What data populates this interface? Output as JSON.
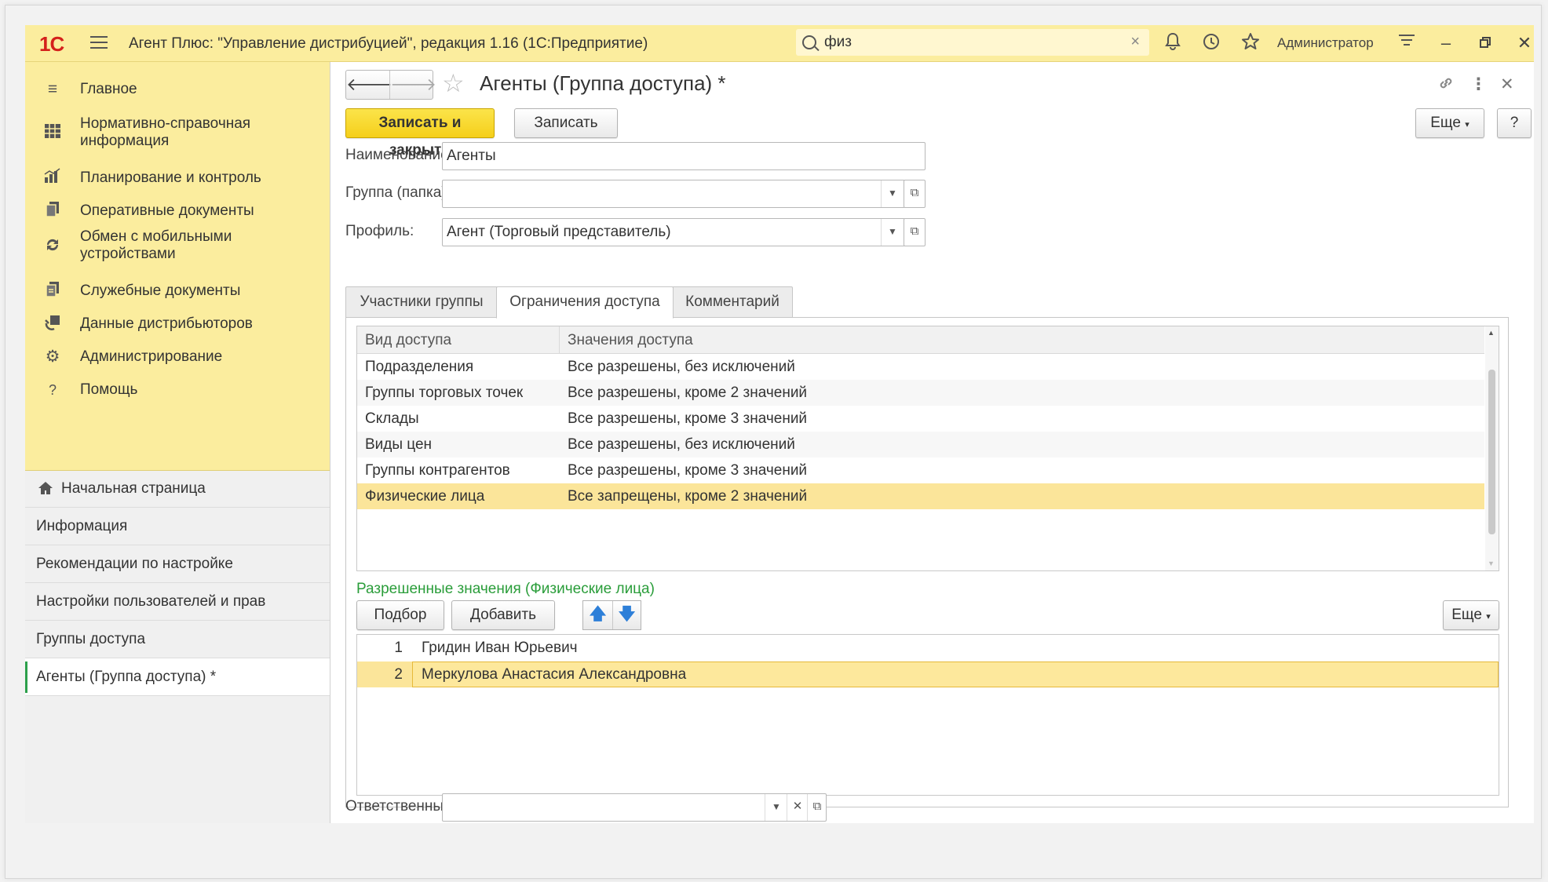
{
  "app": {
    "logo": "1С",
    "title": "Агент Плюс: \"Управление дистрибуцией\", редакция 1.16  (1С:Предприятие)",
    "search_value": "физ",
    "user": "Администратор"
  },
  "sections": [
    {
      "label": "Главное",
      "icon": "menu-icon"
    },
    {
      "label": "Нормативно-справочная информация",
      "icon": "grid-icon"
    },
    {
      "label": "Планирование и контроль",
      "icon": "chart-icon"
    },
    {
      "label": "Оперативные документы",
      "icon": "documents-icon"
    },
    {
      "label": "Обмен с мобильными устройствами",
      "icon": "sync-icon"
    },
    {
      "label": "Служебные документы",
      "icon": "service-documents-icon"
    },
    {
      "label": "Данные дистрибьюторов",
      "icon": "distributor-icon"
    },
    {
      "label": "Администрирование",
      "icon": "gear-icon"
    },
    {
      "label": "Помощь",
      "icon": "help-icon"
    }
  ],
  "nav": [
    {
      "label": "Начальная страница"
    },
    {
      "label": "Информация"
    },
    {
      "label": "Рекомендации по настройке"
    },
    {
      "label": "Настройки пользователей и прав"
    },
    {
      "label": "Группы доступа"
    },
    {
      "label": "Агенты (Группа доступа) *"
    }
  ],
  "form": {
    "title": "Агенты (Группа доступа) *",
    "save_close": "Записать и закрыть",
    "save": "Записать",
    "more": "Еще",
    "help": "?",
    "name_label": "Наименование:",
    "name_value": "Агенты",
    "group_label": "Группа (папка):",
    "group_value": "",
    "profile_label": "Профиль:",
    "profile_value": "Агент (Торговый представитель)",
    "responsible_label": "Ответственный:",
    "responsible_value": ""
  },
  "tabs": [
    {
      "label": "Участники группы"
    },
    {
      "label": "Ограничения доступа"
    },
    {
      "label": "Комментарий"
    }
  ],
  "access_table": {
    "headers": [
      "Вид доступа",
      "Значения доступа"
    ],
    "rows": [
      {
        "kind": "Подразделения",
        "value": "Все разрешены, без исключений"
      },
      {
        "kind": "Группы торговых точек",
        "value": "Все разрешены, кроме 2 значений"
      },
      {
        "kind": "Склады",
        "value": "Все разрешены, кроме 3 значений"
      },
      {
        "kind": "Виды цен",
        "value": "Все разрешены, без исключений"
      },
      {
        "kind": "Группы контрагентов",
        "value": "Все разрешены, кроме 3 значений"
      },
      {
        "kind": "Физические лица",
        "value": "Все запрещены, кроме 2 значений"
      }
    ]
  },
  "allowed": {
    "heading": "Разрешенные значения (Физические лица)",
    "pick": "Подбор",
    "add": "Добавить",
    "more": "Еще",
    "rows": [
      {
        "n": "1",
        "name": "Гридин Иван Юрьевич"
      },
      {
        "n": "2",
        "name": "Меркулова Анастасия Александровна"
      }
    ]
  }
}
